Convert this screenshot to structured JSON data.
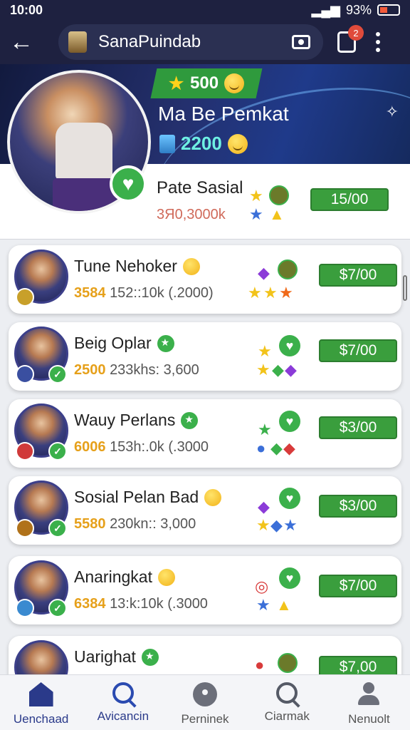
{
  "status_bar": {
    "time": "10:00",
    "battery": "93%"
  },
  "app_bar": {
    "title": "SanaPuindab",
    "notification_count": "2"
  },
  "hero": {
    "stars": "500",
    "player_name": "Ma Be Pemkat",
    "coins": "2200",
    "top_player": {
      "name": "Pate Sasial",
      "score": "3Я0,3000k",
      "price": "15/00"
    }
  },
  "players": [
    {
      "name": "Tune Nehoker",
      "points": "3584",
      "stats": "152::10k (.2000)",
      "price": "$7/00"
    },
    {
      "name": "Beig Oplar",
      "points": "2500",
      "stats": "233khs: 3,600",
      "price": "$7/00"
    },
    {
      "name": "Wauy Perlans",
      "points": "6006",
      "stats": "153h:.0k (.3000",
      "price": "$3/00"
    },
    {
      "name": "Sosial Pelan Bad",
      "points": "5580",
      "stats": "230kn:: 3,000",
      "price": "$3/00"
    },
    {
      "name": "Anaringkat",
      "points": "6384",
      "stats": "13:k:10k (.3000",
      "price": "$7/00"
    },
    {
      "name": "Uarighat",
      "points": "",
      "stats": "",
      "price": "$7,00"
    }
  ],
  "bottom_nav": [
    {
      "label": "Uenchaad",
      "icon": "home-icon"
    },
    {
      "label": "Avicancin",
      "icon": "search-icon"
    },
    {
      "label": "Perninek",
      "icon": "smile-icon"
    },
    {
      "label": "Ciarmak",
      "icon": "magnify-icon"
    },
    {
      "label": "Nenuolt",
      "icon": "person-icon"
    }
  ],
  "colors": {
    "header": "#1e2140",
    "accent_green": "#3a9e3d",
    "highlight": "#e6a01a"
  }
}
